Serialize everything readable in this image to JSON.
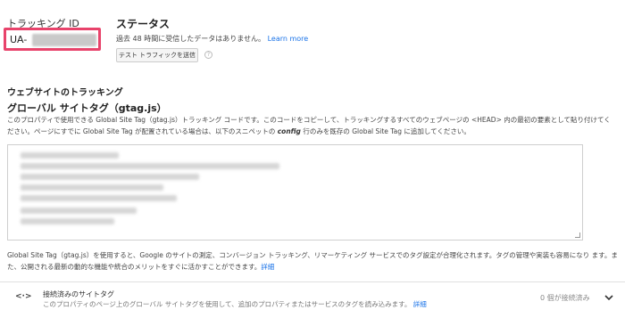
{
  "tracking_id": {
    "label": "トラッキング ID",
    "prefix": "UA-"
  },
  "status": {
    "title": "ステータス",
    "message": "過去 48 時間に受信したデータはありません。",
    "learn_more": "Learn more",
    "test_button": "テスト トラフィックを送信",
    "help_icon": "?"
  },
  "website_tracking": {
    "title": "ウェブサイトのトラッキング"
  },
  "gtag": {
    "title": "グローバル サイトタグ（gtag.js）",
    "desc_part1": "このプロパティで使用できる Global Site Tag（gtag.js）トラッキング コードです。このコードをコピーして、トラッキングするすべてのウェブページの <HEAD> 内の最初の要素として貼り付けてく",
    "desc_part2": "ださい。ページにすでに Global Site Tag が配置されている場合は、以下のスニペットの ",
    "desc_config": "config",
    "desc_part3": " 行のみを既存の Global Site Tag に追加してください。"
  },
  "note": {
    "text": "Global Site Tag（gtag.js）を使用すると、Google のサイトの測定、コンバージョン トラッキング、リマーケティング サービスでのタグ設定が合理化されます。タグの管理や実装も容易になり ます。また、公開される最新の動的な機能や統合のメリットをすぐに活かすことができます。",
    "link": "詳細"
  },
  "connected_tags": {
    "icon": "<·>",
    "title": "接続済みのサイトタグ",
    "subtitle": "このプロパティのページ上のグローバル サイトタグを使用して、追加のプロパティまたはサービスのタグを読み込みます。",
    "subtitle_link": "詳細",
    "count": "0 個が接続済み"
  }
}
